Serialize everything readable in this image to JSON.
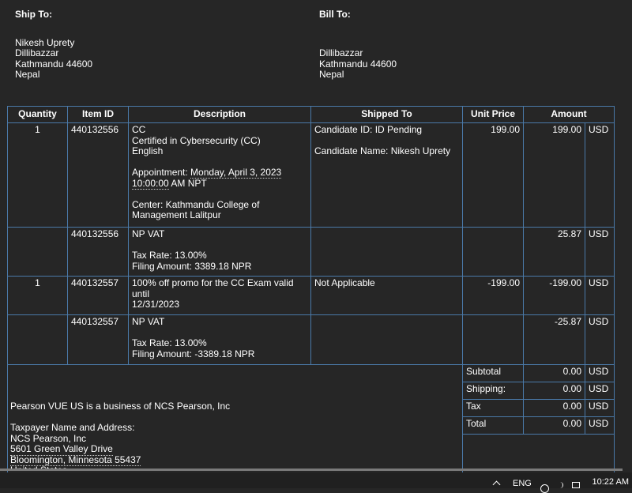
{
  "ship_to": {
    "heading": "Ship To:",
    "lines": [
      "Nikesh Uprety",
      "Dillibazzar",
      "Kathmandu 44600",
      "Nepal"
    ]
  },
  "bill_to": {
    "heading": "Bill To:",
    "lines": [
      "Dillibazzar",
      "Kathmandu 44600",
      "Nepal"
    ]
  },
  "table": {
    "headers": [
      "Quantity",
      "Item ID",
      "Description",
      "Shipped To",
      "Unit Price",
      "Amount"
    ],
    "rows": [
      {
        "quantity": "1",
        "item_id": "440132556",
        "desc": {
          "line1": "CC",
          "line2": "Certified in Cybersecurity (CC)",
          "line3": "English",
          "appt_label": "Appointment: ",
          "appt_date": "Monday, April 3, 2023",
          "appt_time": "10:00:00",
          "appt_tz": " AM NPT",
          "center1": "Center: Kathmandu College of",
          "center2": "Management Lalitpur"
        },
        "shipped1": "Candidate ID: ID Pending",
        "shipped2": "Candidate Name: Nikesh Uprety",
        "unit_price": "199.00",
        "amount": "199.00",
        "currency": "USD"
      },
      {
        "quantity": "",
        "item_id": "440132556",
        "desc": {
          "line1": "NP VAT",
          "line2": "Tax Rate: 13.00%",
          "line3": "Filing Amount: 3389.18 NPR"
        },
        "unit_price": "",
        "amount": "25.87",
        "currency": "USD"
      },
      {
        "quantity": "1",
        "item_id": "440132557",
        "desc": {
          "line1": "100% off promo for the CC Exam valid until",
          "line2": "12/31/2023"
        },
        "shipped1": "Not Applicable",
        "unit_price": "-199.00",
        "amount": "-199.00",
        "currency": "USD"
      },
      {
        "quantity": "",
        "item_id": "440132557",
        "desc": {
          "line1": "NP VAT",
          "line2": "Tax Rate: 13.00%",
          "line3": "Filing Amount: -3389.18 NPR"
        },
        "unit_price": "",
        "amount": "-25.87",
        "currency": "USD"
      }
    ]
  },
  "totals": [
    {
      "label": "Subtotal",
      "value": "0.00",
      "currency": "USD"
    },
    {
      "label": "Shipping:",
      "value": "0.00",
      "currency": "USD"
    },
    {
      "label": "Tax",
      "value": "0.00",
      "currency": "USD"
    },
    {
      "label": "Total",
      "value": "0.00",
      "currency": "USD"
    }
  ],
  "footer": {
    "business": "Pearson VUE US is a business of NCS Pearson, Inc",
    "taxpayer_label": "Taxpayer Name and Address:",
    "company": "NCS Pearson, Inc",
    "street": "5601 Green Valley Drive",
    "city": "Bloomington, Minnesota 55437",
    "country": "United States"
  },
  "taskbar": {
    "language": "ENG",
    "time": "10:22 AM"
  }
}
